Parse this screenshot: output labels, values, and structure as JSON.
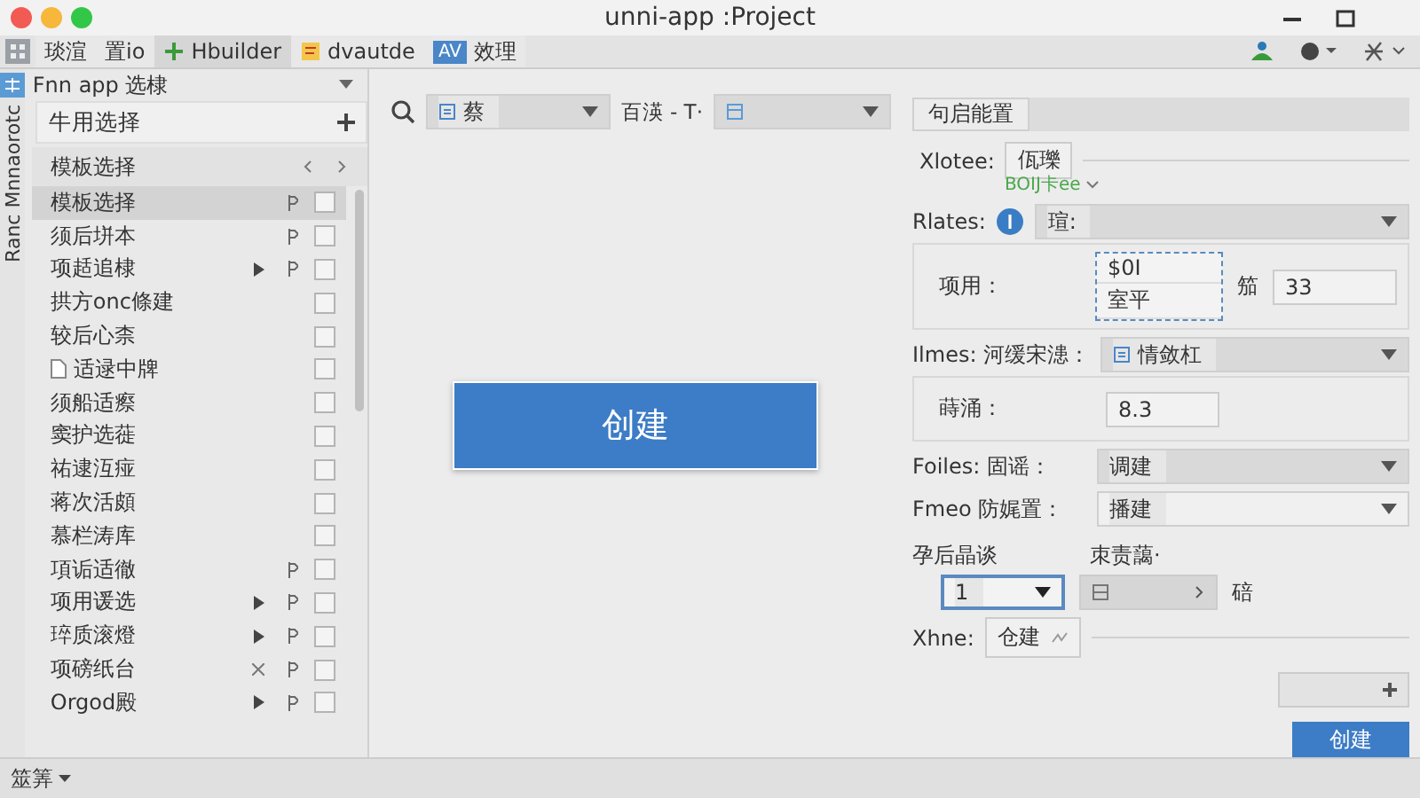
{
  "window": {
    "title": "unni-app :Project"
  },
  "tabs": [
    {
      "label": "琰渲",
      "kind": "plain",
      "selected": false
    },
    {
      "label": "置io",
      "kind": "plain",
      "selected": false
    },
    {
      "label": "Hbuilder",
      "kind": "plus",
      "selected": true
    },
    {
      "label": "dvautde",
      "kind": "doc",
      "selected": false
    },
    {
      "label": "效理",
      "kind": "badge",
      "badge": "AV",
      "selected": false
    }
  ],
  "side_strip": {
    "label": "Ranc Mnnaorotc"
  },
  "left_panel": {
    "title": "Fnn app 选棣",
    "picker": "牛用选择",
    "section": "模板选择",
    "items": [
      {
        "label": "模板选择",
        "kind": "plain",
        "flag": true,
        "checked": false,
        "selected": true
      },
      {
        "label": "须后垪本",
        "kind": "plain",
        "flag": true,
        "checked": false,
        "selected": false
      },
      {
        "label": "项趏追棣",
        "kind": "arrow",
        "flag": true,
        "checked": false,
        "selected": false
      },
      {
        "label": "拱方onc條建",
        "kind": "plain",
        "flag": false,
        "checked": false,
        "selected": false
      },
      {
        "label": "较后心柰",
        "kind": "plain",
        "flag": false,
        "checked": false,
        "selected": false
      },
      {
        "label": "适逯中牌",
        "kind": "file",
        "flag": false,
        "checked": false,
        "selected": false
      },
      {
        "label": "须船适瘵",
        "kind": "plain",
        "flag": false,
        "checked": false,
        "selected": false
      },
      {
        "label": "窦护选蓰",
        "kind": "plain",
        "flag": false,
        "checked": false,
        "selected": false
      },
      {
        "label": "祐逮沍痖",
        "kind": "plain",
        "flag": false,
        "checked": false,
        "selected": false
      },
      {
        "label": "蒋次活頗",
        "kind": "plain",
        "flag": false,
        "checked": false,
        "selected": false
      },
      {
        "label": "慕栏涛库",
        "kind": "plain",
        "flag": false,
        "checked": false,
        "selected": false
      },
      {
        "label": "項诟适徹",
        "kind": "plain",
        "flag": true,
        "checked": false,
        "selected": false
      },
      {
        "label": "项用谖选",
        "kind": "arrow",
        "flag": true,
        "checked": false,
        "selected": false
      },
      {
        "label": "琗质滚燈",
        "kind": "arrow",
        "flag": true,
        "checked": false,
        "selected": false
      },
      {
        "label": "项磅纸台",
        "kind": "cross",
        "flag": true,
        "checked": false,
        "selected": false
      },
      {
        "label": "Orgod殿",
        "kind": "arrow",
        "flag": true,
        "checked": false,
        "selected": false
      }
    ]
  },
  "search_bar": {
    "select": "蔡",
    "label": "百渶 - T·"
  },
  "create_button": "创建",
  "right_panel": {
    "tab": "句启能置",
    "name_label": "Xlotee:",
    "name_value": "佤瓅",
    "link": "BOIJ卡ee",
    "rates_label": "Rlates:",
    "rates_select": "瑄:",
    "apply_label": "项用：",
    "apply_options": [
      "$0I",
      "室平"
    ],
    "apply_unit": "笳",
    "apply_value": "33",
    "times_label": "Ilmes: 河缓宋漶：",
    "times_select": "情敛杠",
    "ratio_label": "蒔涌：",
    "ratio_value": "8.3",
    "files_label": "Foiles: 固谣：",
    "files_select": "调建",
    "frame_label": "Fmeo 防娓置：",
    "frame_select": "播建",
    "count_label": "孕后晶谈",
    "count_select": "1",
    "range_label": "朿责藹·",
    "range_unit": "碚",
    "xhne_label": "Xhne:",
    "xhne_value": "仓建",
    "submit": "创建"
  },
  "status_bar": {
    "menu": "筮筭"
  }
}
